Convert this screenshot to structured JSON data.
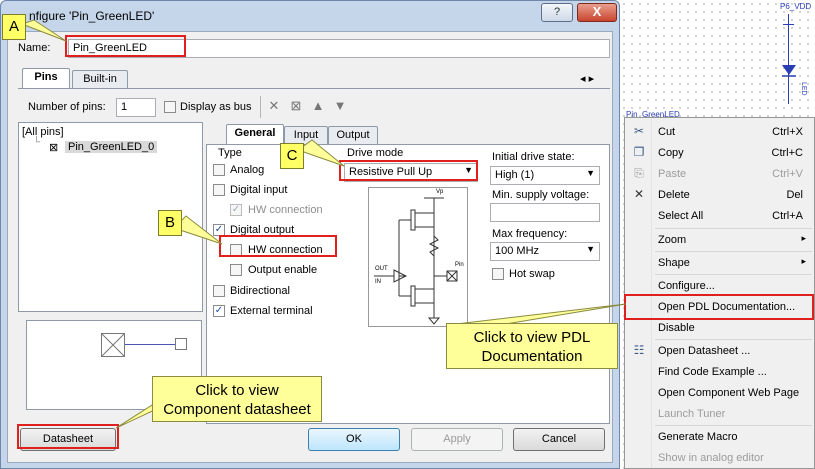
{
  "dialog": {
    "title": "nfigure 'Pin_GreenLED'",
    "help_glyph": "?",
    "close_glyph": "X",
    "name_label": "Name:",
    "name_value": "Pin_GreenLED",
    "tabs": [
      "Pins",
      "Built-in"
    ],
    "tab_scroll": "◂ ▸",
    "num_pins_label": "Number of pins:",
    "num_pins_value": "1",
    "display_as_bus": "Display as bus",
    "tree": {
      "root": "[All pins]",
      "pin": "Pin_GreenLED_0"
    },
    "sub_tabs": [
      "General",
      "Input",
      "Output"
    ],
    "type": {
      "heading": "Type",
      "analog": "Analog",
      "digital_input": "Digital input",
      "hw_connection_in": "HW connection",
      "digital_output": "Digital output",
      "hw_connection_out": "HW connection",
      "output_enable": "Output enable",
      "bidirectional": "Bidirectional",
      "external_terminal": "External terminal"
    },
    "drive_mode": {
      "heading": "Drive mode",
      "value": "Resistive Pull Up"
    },
    "initial_drive_state": {
      "label": "Initial drive state:",
      "value": "High (1)"
    },
    "min_supply_voltage": {
      "label": "Min. supply voltage:",
      "value": ""
    },
    "max_frequency": {
      "label": "Max frequency:",
      "value": "100 MHz"
    },
    "hot_swap": "Hot swap",
    "schematic_labels": {
      "vdd": "Vp",
      "out": "OUT",
      "in": "IN",
      "pin": "Pin"
    },
    "buttons": {
      "datasheet": "Datasheet",
      "ok": "OK",
      "apply": "Apply",
      "cancel": "Cancel"
    }
  },
  "callouts": {
    "a": "A",
    "b": "B",
    "c": "C",
    "pdl_line1": "Click to view PDL",
    "pdl_line2": "Documentation",
    "ds_line1": "Click to view",
    "ds_line2": "Component datasheet"
  },
  "schematic": {
    "vdd_label": "P6_VDD",
    "led_label": "LED",
    "component_label": "Pin_GreenLED"
  },
  "context_menu": {
    "items": [
      {
        "label": "Cut",
        "shortcut": "Ctrl+X",
        "icon": "scissors-icon",
        "glyph": "✂",
        "disabled": false
      },
      {
        "label": "Copy",
        "shortcut": "Ctrl+C",
        "icon": "copy-icon",
        "glyph": "❐",
        "disabled": false
      },
      {
        "label": "Paste",
        "shortcut": "Ctrl+V",
        "icon": "paste-icon",
        "glyph": "⎘",
        "disabled": true
      },
      {
        "label": "Delete",
        "shortcut": "Del",
        "icon": "delete-icon",
        "glyph": "✕",
        "disabled": false
      },
      {
        "label": "Select All",
        "shortcut": "Ctrl+A",
        "icon": "",
        "glyph": "",
        "disabled": false
      },
      {
        "label": "Zoom",
        "shortcut": "",
        "icon": "",
        "glyph": "",
        "disabled": false,
        "submenu": true
      },
      {
        "label": "Shape",
        "shortcut": "",
        "icon": "",
        "glyph": "",
        "disabled": false,
        "submenu": true
      },
      {
        "label": "Configure...",
        "shortcut": "",
        "icon": "",
        "glyph": "",
        "disabled": false
      },
      {
        "label": "Open PDL Documentation...",
        "shortcut": "",
        "icon": "",
        "glyph": "",
        "disabled": false
      },
      {
        "label": "Disable",
        "shortcut": "",
        "icon": "",
        "glyph": "",
        "disabled": false
      },
      {
        "label": "Open Datasheet ...",
        "shortcut": "",
        "icon": "datasheet-icon",
        "glyph": "☷",
        "disabled": false
      },
      {
        "label": "Find Code Example ...",
        "shortcut": "",
        "icon": "",
        "glyph": "",
        "disabled": false
      },
      {
        "label": "Open Component Web Page",
        "shortcut": "",
        "icon": "",
        "glyph": "",
        "disabled": false
      },
      {
        "label": "Launch Tuner",
        "shortcut": "",
        "icon": "",
        "glyph": "",
        "disabled": true
      },
      {
        "label": "Generate Macro",
        "shortcut": "",
        "icon": "",
        "glyph": "",
        "disabled": false
      },
      {
        "label": "Show in analog editor",
        "shortcut": "",
        "icon": "",
        "glyph": "",
        "disabled": true
      }
    ],
    "submenu_glyph": "▸"
  },
  "colors": {
    "highlight_red": "#e0201c",
    "callout_yellow": "#ffff99",
    "window_frame": "#c6d6ea"
  }
}
